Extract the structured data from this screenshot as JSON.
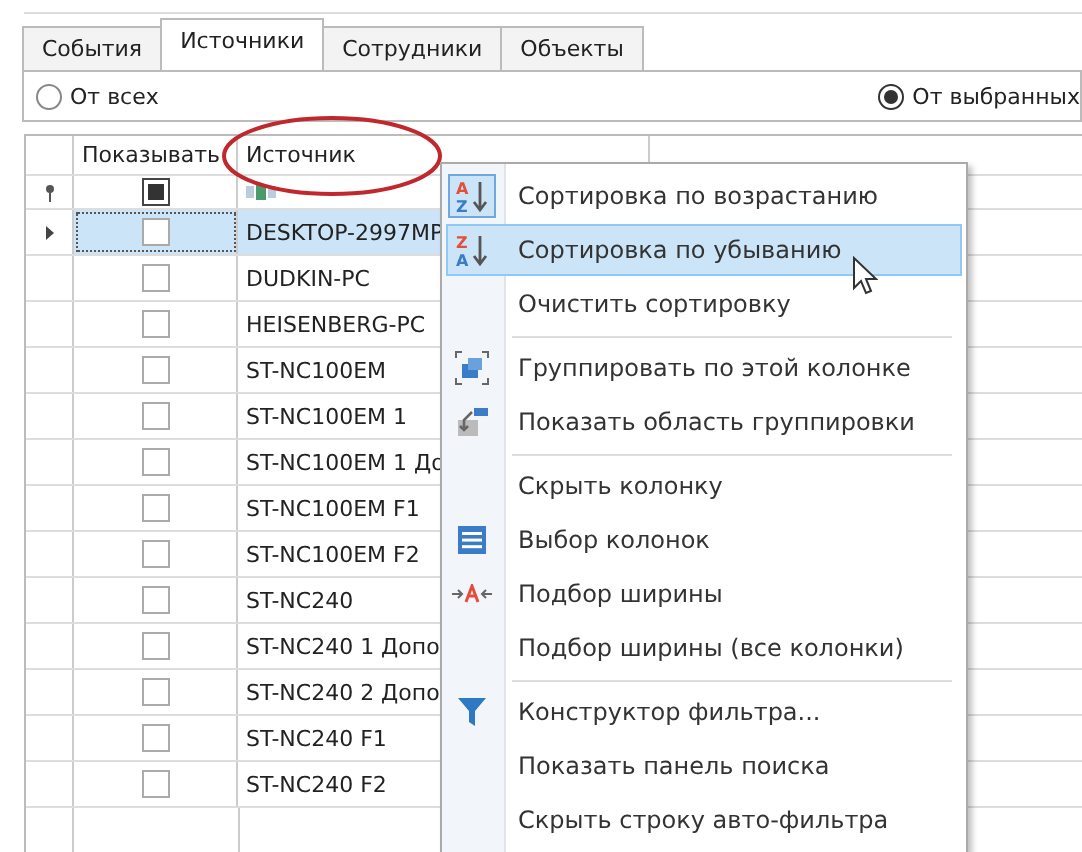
{
  "tabs": [
    {
      "label": "События",
      "selected": false
    },
    {
      "label": "Источники",
      "selected": true
    },
    {
      "label": "Сотрудники",
      "selected": false
    },
    {
      "label": "Объекты",
      "selected": false
    }
  ],
  "source_filter": [
    {
      "label": "От всех",
      "selected": false
    },
    {
      "label": "От выбранных",
      "selected": true
    }
  ],
  "grid": {
    "columns": [
      "Показывать",
      "Источник"
    ],
    "filter_row": {
      "checked": true
    },
    "rows": [
      {
        "name": "DESKTOP-2997MP",
        "checked": false,
        "selected": true
      },
      {
        "name": "DUDKIN-PC",
        "checked": false,
        "selected": false
      },
      {
        "name": "HEISENBERG-PC",
        "checked": false,
        "selected": false
      },
      {
        "name": "ST-NC100EM",
        "checked": false,
        "selected": false
      },
      {
        "name": "ST-NC100EM 1",
        "checked": false,
        "selected": false
      },
      {
        "name": "ST-NC100EM 1 До",
        "checked": false,
        "selected": false
      },
      {
        "name": "ST-NC100EM F1",
        "checked": false,
        "selected": false
      },
      {
        "name": "ST-NC100EM F2",
        "checked": false,
        "selected": false
      },
      {
        "name": "ST-NC240",
        "checked": false,
        "selected": false
      },
      {
        "name": "ST-NC240 1 Допо",
        "checked": false,
        "selected": false
      },
      {
        "name": "ST-NC240 2 Допо",
        "checked": false,
        "selected": false
      },
      {
        "name": "ST-NC240 F1",
        "checked": false,
        "selected": false
      },
      {
        "name": "ST-NC240 F2",
        "checked": false,
        "selected": false
      }
    ]
  },
  "context_menu": [
    {
      "label": "Сортировка по возрастанию",
      "kind": "sort-asc",
      "icon_letters": [
        "A",
        "Z"
      ],
      "checked": true,
      "highlighted": false,
      "separator_before": false
    },
    {
      "label": "Сортировка по убыванию",
      "kind": "sort-desc",
      "icon_letters": [
        "Z",
        "A"
      ],
      "checked": false,
      "highlighted": true,
      "separator_before": false
    },
    {
      "label": "Очистить сортировку",
      "kind": "none",
      "checked": false,
      "highlighted": false,
      "separator_before": false
    },
    {
      "label": "Группировать по этой колонке",
      "kind": "group",
      "checked": false,
      "highlighted": false,
      "separator_before": true
    },
    {
      "label": "Показать область группировки",
      "kind": "group-panel",
      "checked": false,
      "highlighted": false,
      "separator_before": false
    },
    {
      "label": "Скрыть колонку",
      "kind": "none",
      "checked": false,
      "highlighted": false,
      "separator_before": true
    },
    {
      "label": "Выбор колонок",
      "kind": "columns",
      "checked": false,
      "highlighted": false,
      "separator_before": false
    },
    {
      "label": "Подбор ширины",
      "kind": "best-fit",
      "checked": false,
      "highlighted": false,
      "separator_before": false
    },
    {
      "label": "Подбор ширины (все колонки)",
      "kind": "none",
      "checked": false,
      "highlighted": false,
      "separator_before": false
    },
    {
      "label": "Конструктор фильтра...",
      "kind": "filter",
      "checked": false,
      "highlighted": false,
      "separator_before": true
    },
    {
      "label": "Показать панель поиска",
      "kind": "none",
      "checked": false,
      "highlighted": false,
      "separator_before": false
    },
    {
      "label": "Скрыть строку авто-фильтра",
      "kind": "none",
      "checked": false,
      "highlighted": false,
      "separator_before": false
    }
  ]
}
